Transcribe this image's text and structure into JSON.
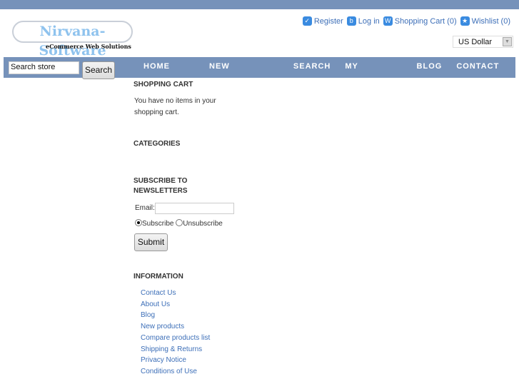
{
  "logo": {
    "name": "Nirvana-Software",
    "tagline": "eCommerce Web Solutions"
  },
  "header": {
    "links": [
      {
        "label": "Register",
        "icon": "check-icon",
        "glyph": "✓"
      },
      {
        "label": "Log in",
        "icon": "lock-icon",
        "glyph": "b"
      },
      {
        "label": "Shopping Cart (0)",
        "icon": "cart-icon",
        "glyph": "W"
      },
      {
        "label": "Wishlist (0)",
        "icon": "star-icon",
        "glyph": "★"
      }
    ],
    "currency": "US Dollar"
  },
  "search": {
    "value": "Search store",
    "button": "Search"
  },
  "menu": [
    "HOME PAGE",
    "NEW PRODUCTS",
    "SEARCH",
    "MY ACCOUNT",
    "BLOG",
    "CONTACT US"
  ],
  "cart": {
    "title": "SHOPPING CART",
    "message_line1": "You have no items in your",
    "message_line2": "shopping cart."
  },
  "categories": {
    "title": "CATEGORIES"
  },
  "newsletter": {
    "title_line1": "SUBSCRIBE TO",
    "title_line2": "NEWSLETTERS",
    "email_label": "Email:",
    "subscribe": "Subscribe",
    "unsubscribe": "Unsubscribe",
    "submit": "Submit"
  },
  "information": {
    "title": "INFORMATION",
    "links": [
      "Contact Us",
      "About Us",
      "Blog",
      "New products",
      "Compare products list",
      "Shipping & Returns",
      "Privacy Notice",
      "Conditions of Use"
    ]
  }
}
